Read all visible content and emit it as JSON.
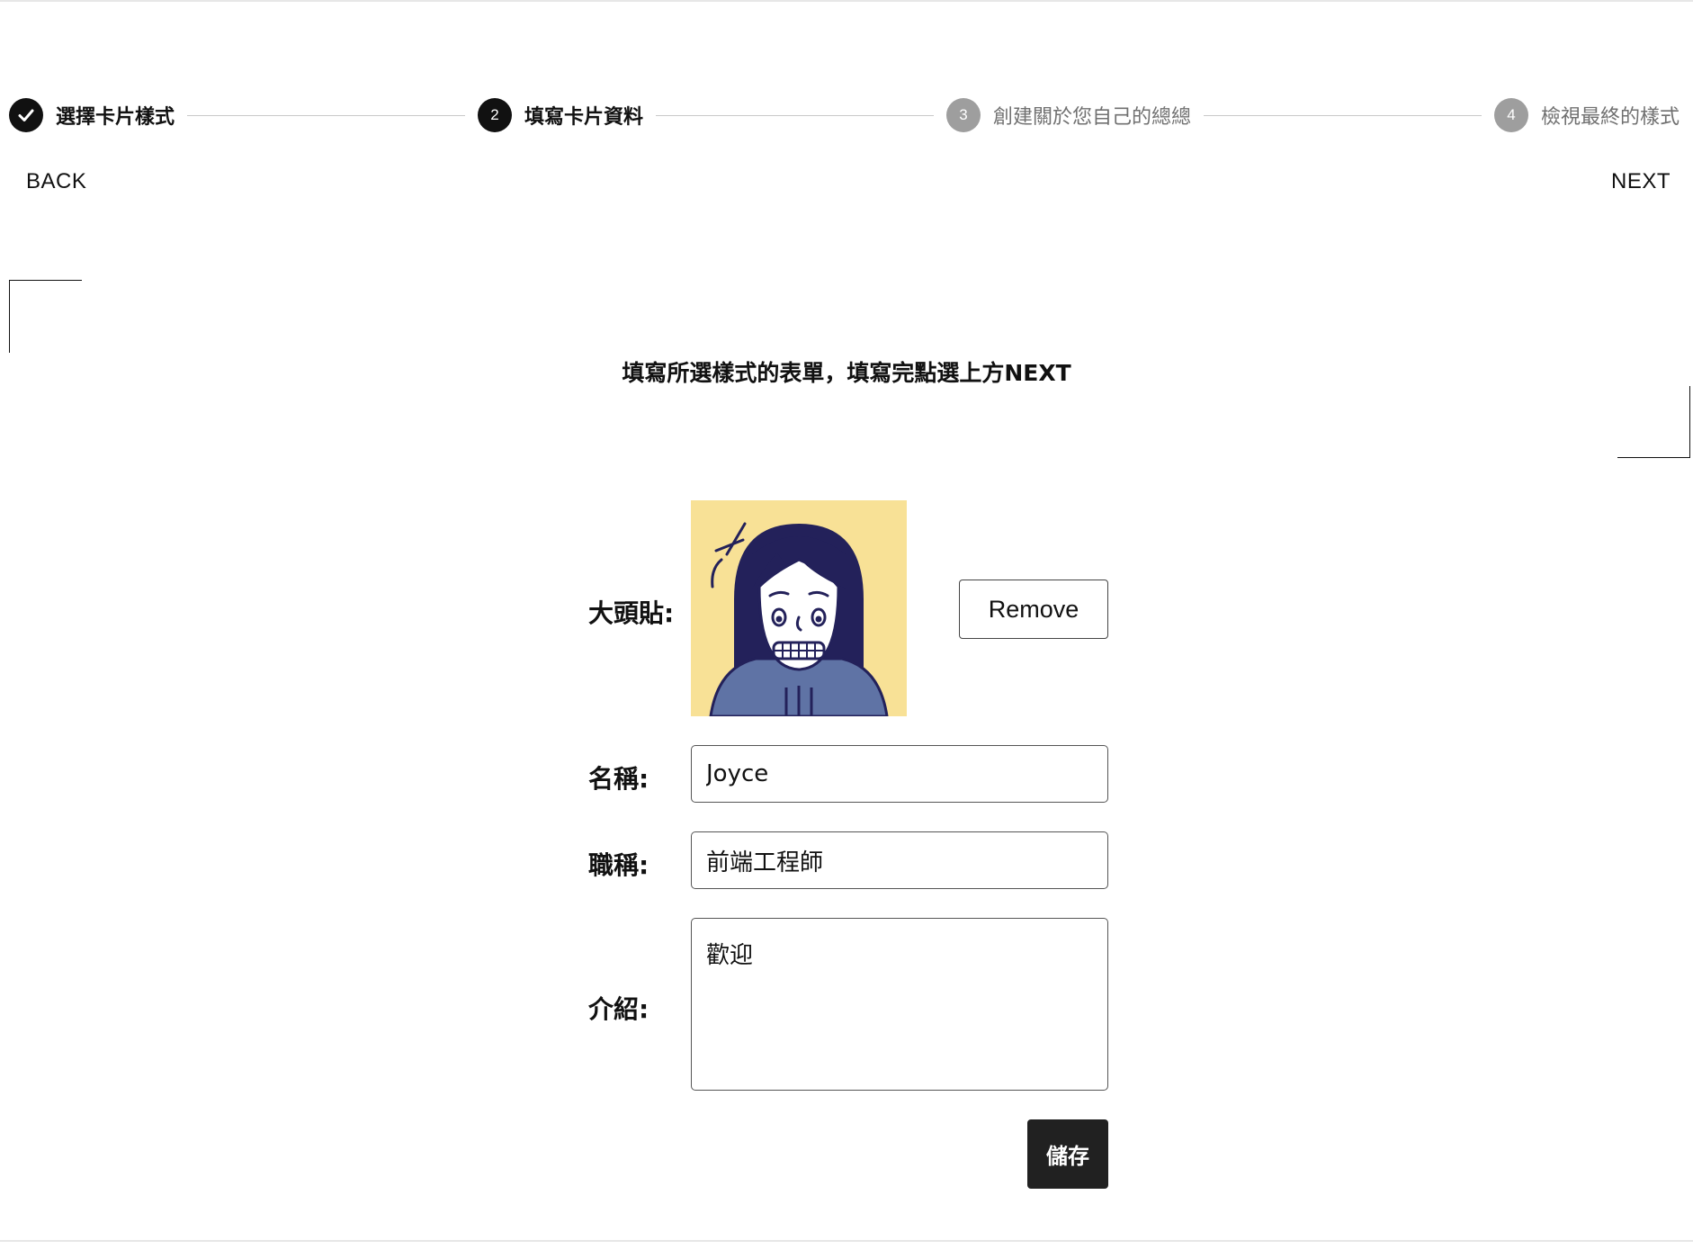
{
  "stepper": {
    "steps": [
      {
        "number": "",
        "label": "選擇卡片樣式",
        "status": "completed",
        "icon": "check-icon"
      },
      {
        "number": "2",
        "label": "填寫卡片資料",
        "status": "active"
      },
      {
        "number": "3",
        "label": "創建關於您自己的總總",
        "status": "pending"
      },
      {
        "number": "4",
        "label": "檢視最終的樣式",
        "status": "pending"
      }
    ]
  },
  "nav": {
    "back_label": "BACK",
    "next_label": "NEXT"
  },
  "instruction": "填寫所選樣式的表單，填寫完點選上方NEXT",
  "form": {
    "avatar": {
      "label": "大頭貼:",
      "remove_label": "Remove",
      "image": "avatar-illustration"
    },
    "name": {
      "label": "名稱:",
      "value": "Joyce"
    },
    "title": {
      "label": "職稱:",
      "value": "前端工程師"
    },
    "intro": {
      "label": "介紹:",
      "value": "歡迎"
    },
    "save_label": "儲存"
  },
  "colors": {
    "avatar_background": "#f8e196",
    "hair": "#23215a",
    "sweater": "#5f73a5",
    "step_active": "#111111",
    "step_pending": "#9e9e9e",
    "save_button": "#212121"
  }
}
